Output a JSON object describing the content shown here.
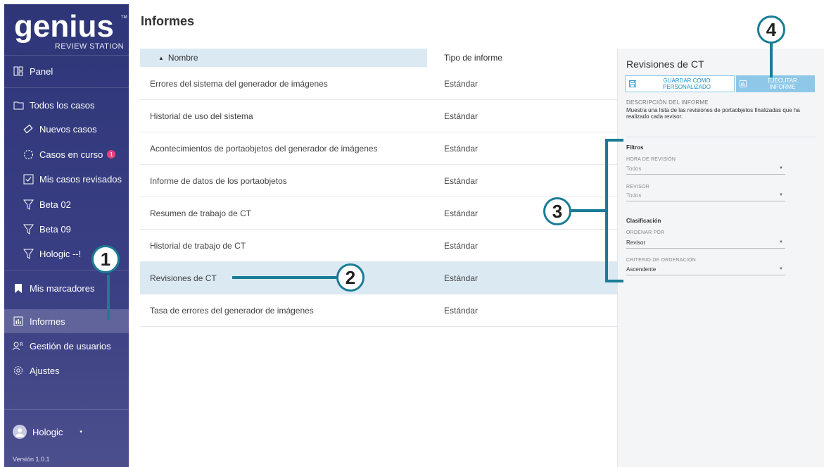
{
  "brand": {
    "name": "genius",
    "tm": "TM",
    "subtitle": "REVIEW STATION"
  },
  "sidebar": {
    "items": [
      {
        "label": "Panel",
        "icon": "grid-icon"
      },
      {
        "label": "Todos los casos",
        "icon": "folder-icon"
      },
      {
        "label": "Nuevos casos",
        "icon": "slide-icon"
      },
      {
        "label": "Casos en curso",
        "icon": "progress-icon",
        "badge": "1"
      },
      {
        "label": "Mis casos revisados",
        "icon": "checkbox-icon"
      },
      {
        "label": "Beta 02",
        "icon": "filter-icon"
      },
      {
        "label": "Beta 09",
        "icon": "filter-icon"
      },
      {
        "label": "Hologic --!",
        "icon": "filter-icon"
      },
      {
        "label": "Mis marcadores",
        "icon": "bookmark-icon"
      },
      {
        "label": "Informes",
        "icon": "chart-icon"
      },
      {
        "label": "Gestión de usuarios",
        "icon": "users-icon"
      },
      {
        "label": "Ajustes",
        "icon": "gear-icon"
      }
    ],
    "user": "Hologic",
    "version": "Versión 1.0.1"
  },
  "main": {
    "title": "Informes",
    "columns": [
      "Nombre",
      "Tipo de informe"
    ],
    "rows": [
      {
        "name": "Errores del sistema del generador de imágenes",
        "type": "Estándar"
      },
      {
        "name": "Historial de uso del sistema",
        "type": "Estándar"
      },
      {
        "name": "Acontecimientos de portaobjetos del generador de imágenes",
        "type": "Estándar"
      },
      {
        "name": "Informe de datos de los portaobjetos",
        "type": "Estándar"
      },
      {
        "name": "Resumen de trabajo de CT",
        "type": "Estándar"
      },
      {
        "name": "Historial de trabajo de CT",
        "type": "Estándar"
      },
      {
        "name": "Revisiones de CT",
        "type": "Estándar"
      },
      {
        "name": "Tasa de errores del generador de imágenes",
        "type": "Estándar"
      }
    ],
    "selected_index": 6
  },
  "panel": {
    "title": "Revisiones de CT",
    "save_label_1": "GUARDAR COMO",
    "save_label_2": "PERSONALIZADO",
    "run_label_1": "EJECUTAR",
    "run_label_2": "INFORME",
    "desc_header": "DESCRIPCIÓN DEL INFORME",
    "description": "Muestra una lista de las revisiones de portaobjetos finalizadas que ha realizado cada revisor.",
    "filters_header": "Filtros",
    "review_time_label": "HORA DE REVISIÓN",
    "review_time_value": "Todos",
    "reviewer_label": "REVISOR",
    "reviewer_value": "Todos",
    "sort_header": "Clasificación",
    "sort_by_label": "ORDENAR POR",
    "sort_by_value": "Revisor",
    "order_label": "CRITERIO DE ORDENACIÓN",
    "order_value": "Ascendente"
  },
  "callouts": [
    "1",
    "2",
    "3",
    "4"
  ],
  "colors": {
    "sidebar": "#2e3678",
    "accent": "#1b7c95",
    "selected_row": "#dbe9f3",
    "run_button": "#8ec8e8",
    "badge": "#e8427c"
  }
}
